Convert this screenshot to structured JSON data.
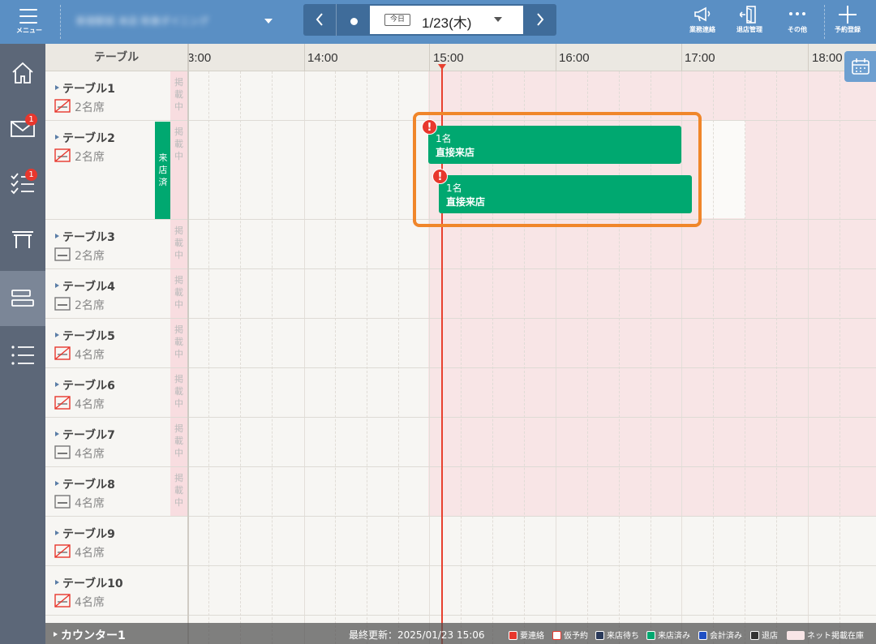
{
  "topbar": {
    "menu_label": "メニュー",
    "store_name": "新宿駅前 本店 和食ダイニング",
    "today_label": "今日",
    "date": "1/23(木)",
    "actions": [
      {
        "label": "業務連絡",
        "icon": "megaphone-icon"
      },
      {
        "label": "退店管理",
        "icon": "exit-door-icon"
      },
      {
        "label": "その他",
        "icon": "more-dots-icon"
      },
      {
        "label": "予約登録",
        "icon": "plus-icon"
      }
    ]
  },
  "sidebar": {
    "items": [
      {
        "name": "home",
        "icon": "home-icon"
      },
      {
        "name": "mail",
        "icon": "mail-icon",
        "badge": "1"
      },
      {
        "name": "checklist",
        "icon": "checklist-icon",
        "badge": "1"
      },
      {
        "name": "table",
        "icon": "table-icon"
      },
      {
        "name": "timeline",
        "icon": "timeline-icon"
      },
      {
        "name": "list",
        "icon": "list-icon"
      }
    ]
  },
  "header": {
    "table_col": "テーブル",
    "times": [
      "3:00",
      "14:00",
      "15:00",
      "16:00",
      "17:00",
      "18:00"
    ]
  },
  "labels": {
    "listed": "掲載中",
    "visited": "来店済"
  },
  "tables": [
    {
      "name": "テーブル1",
      "seats": "2名席",
      "seat_type": "nosmoke",
      "listed": true
    },
    {
      "name": "テーブル2",
      "seats": "2名席",
      "seat_type": "nosmoke",
      "listed": true,
      "visited": true
    },
    {
      "name": "テーブル3",
      "seats": "2名席",
      "seat_type": "smoke",
      "listed": true
    },
    {
      "name": "テーブル4",
      "seats": "2名席",
      "seat_type": "smoke",
      "listed": true
    },
    {
      "name": "テーブル5",
      "seats": "4名席",
      "seat_type": "nosmoke",
      "listed": true
    },
    {
      "name": "テーブル6",
      "seats": "4名席",
      "seat_type": "nosmoke",
      "listed": true
    },
    {
      "name": "テーブル7",
      "seats": "4名席",
      "seat_type": "smoke",
      "listed": true
    },
    {
      "name": "テーブル8",
      "seats": "4名席",
      "seat_type": "smoke",
      "listed": true
    },
    {
      "name": "テーブル9",
      "seats": "4名席",
      "seat_type": "nosmoke",
      "listed": false
    },
    {
      "name": "テーブル10",
      "seats": "4名席",
      "seat_type": "nosmoke",
      "listed": false
    },
    {
      "name": "カウンター1",
      "seats": "",
      "seat_type": "nosmoke",
      "listed": false
    }
  ],
  "reservations": [
    {
      "people": "1名",
      "source": "直接来店",
      "alert": "!"
    },
    {
      "people": "1名",
      "source": "直接来店",
      "alert": "!"
    }
  ],
  "footer": {
    "last_updated": "最終更新：2025/01/23 15:06",
    "legend": [
      {
        "label": "要連絡",
        "color": "#e8372d"
      },
      {
        "label": "仮予約",
        "color": "#ffffff",
        "border": "#e8372d"
      },
      {
        "label": "来店待ち",
        "color": "#2a3a5a"
      },
      {
        "label": "来店済み",
        "color": "#00a870"
      },
      {
        "label": "会計済み",
        "color": "#1f4fc4"
      },
      {
        "label": "退店",
        "color": "#333333"
      },
      {
        "label": "ネット掲載在庫",
        "color": "#f8e5e6"
      }
    ]
  },
  "colors": {
    "topbar": "#5a8fc4",
    "sidebar": "#5c6778",
    "visited_green": "#00a870",
    "now_line": "#e8412f",
    "highlight": "#f0862a",
    "alert": "#e8372d"
  }
}
